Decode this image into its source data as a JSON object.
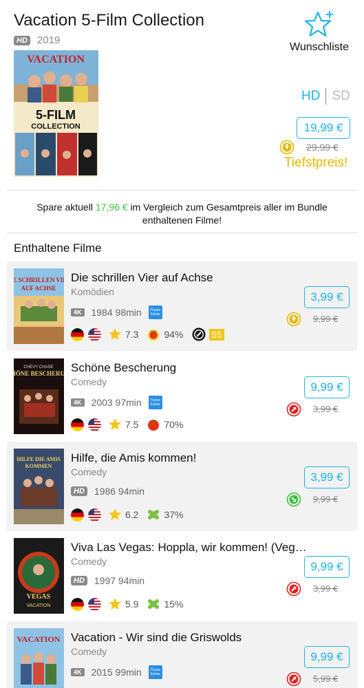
{
  "header": {
    "title": "Vacation 5-Film Collection",
    "quality_badge": "HD",
    "year": "2019",
    "wishlist_label": "Wunschliste",
    "format_hd": "HD",
    "format_sd": "SD",
    "price": "19,99 €",
    "old_price": "29,99 €",
    "lowest_label": "Tiefstpreis!"
  },
  "savings": {
    "prefix": "Spare aktuell",
    "amount": "17,96 €",
    "suffix": "im Vergleich zum Gesamtpreis aller im Bundle enthaltenen Filme!"
  },
  "section_title": "Enthaltene Filme",
  "colors": {
    "accent": "#1eb4e6",
    "gold": "#e5b800",
    "green": "#3ec23e",
    "red": "#e02020"
  },
  "films": [
    {
      "title": "Die schrillen Vier auf Achse",
      "genre": "Komödien",
      "quality": "4K",
      "year_runtime": "1984 98min",
      "itunes_extras": "iTunes Extras",
      "imdb": "7.3",
      "score2": "94%",
      "score2_icon": "rotten-tomatoes-certified-icon",
      "metacritic": "55",
      "price": "3,99 €",
      "old_price": "9,99 €",
      "trend": "price-down-icon"
    },
    {
      "title": "Schöne Bescherung",
      "genre": "Comedy",
      "quality": "4K",
      "year_runtime": "2003 97min",
      "itunes_extras": "iTunes Extras",
      "imdb": "7.5",
      "score2": "70%",
      "score2_icon": "tomato-icon",
      "price": "9,99 €",
      "old_price": "3,99 €",
      "trend": "price-up-icon"
    },
    {
      "title": "Hilfe, die Amis kommen!",
      "genre": "Comedy",
      "quality": "HD",
      "year_runtime": "1986 94min",
      "imdb": "6.2",
      "score2": "37%",
      "score2_icon": "splat-icon",
      "price": "3,99 €",
      "old_price": "9,99 €",
      "trend": "price-down-green-icon"
    },
    {
      "title": "Viva Las Vegas: Hoppla, wir kommen! (Veg…",
      "genre": "Comedy",
      "quality": "HD",
      "year_runtime": "1997 94min",
      "imdb": "5.9",
      "score2": "15%",
      "score2_icon": "splat-icon",
      "price": "9,99 €",
      "old_price": "3,99 €",
      "trend": "price-up-icon"
    },
    {
      "title": "Vacation - Wir sind die Griswolds",
      "genre": "Comedy",
      "quality": "4K",
      "year_runtime": "2015 99min",
      "itunes_extras": "iTunes Extras",
      "price": "9,99 €",
      "old_price": "5,99 €",
      "trend": "price-up-icon"
    }
  ]
}
